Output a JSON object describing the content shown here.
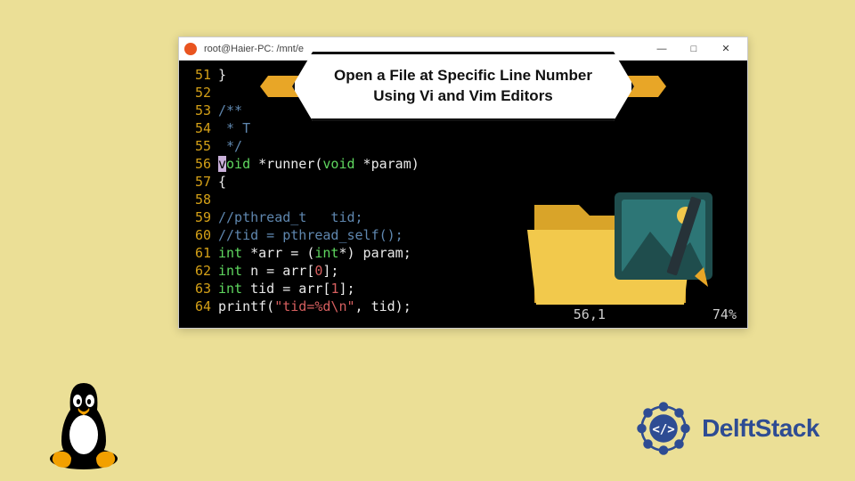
{
  "titlebar": {
    "title": "root@Haier-PC: /mnt/e",
    "min": "—",
    "max": "□",
    "close": "✕"
  },
  "overlay": {
    "line1": "Open a File at Specific Line Number",
    "line2": "Using Vi and Vim Editors"
  },
  "code": {
    "lines": [
      {
        "num": "51",
        "tokens": [
          {
            "cls": "tok-white",
            "t": "}"
          }
        ]
      },
      {
        "num": "52",
        "tokens": []
      },
      {
        "num": "53",
        "tokens": [
          {
            "cls": "tok-comment",
            "t": "/**"
          }
        ]
      },
      {
        "num": "54",
        "tokens": [
          {
            "cls": "tok-comment",
            "t": " * T"
          }
        ]
      },
      {
        "num": "55",
        "tokens": [
          {
            "cls": "tok-comment",
            "t": " */"
          }
        ]
      },
      {
        "num": "56",
        "tokens": [
          {
            "cls": "cursor-bg",
            "t": "v"
          },
          {
            "cls": "tok-keyword",
            "t": "oid"
          },
          {
            "cls": "tok-white",
            "t": " *runner("
          },
          {
            "cls": "tok-keyword",
            "t": "void"
          },
          {
            "cls": "tok-white",
            "t": " *param)"
          }
        ]
      },
      {
        "num": "57",
        "tokens": [
          {
            "cls": "tok-white",
            "t": "{"
          }
        ]
      },
      {
        "num": "58",
        "tokens": []
      },
      {
        "num": "59",
        "tokens": [
          {
            "cls": "tok-comment",
            "t": "//pthread_t   tid;"
          }
        ]
      },
      {
        "num": "60",
        "tokens": [
          {
            "cls": "tok-comment",
            "t": "//tid = pthread_self();"
          }
        ]
      },
      {
        "num": "61",
        "tokens": [
          {
            "cls": "tok-keyword",
            "t": "int"
          },
          {
            "cls": "tok-white",
            "t": " *arr = ("
          },
          {
            "cls": "tok-keyword",
            "t": "int"
          },
          {
            "cls": "tok-white",
            "t": "*) param;"
          }
        ]
      },
      {
        "num": "62",
        "tokens": [
          {
            "cls": "tok-keyword",
            "t": "int"
          },
          {
            "cls": "tok-white",
            "t": " n = arr["
          },
          {
            "cls": "tok-number",
            "t": "0"
          },
          {
            "cls": "tok-white",
            "t": "];"
          }
        ]
      },
      {
        "num": "63",
        "tokens": [
          {
            "cls": "tok-keyword",
            "t": "int"
          },
          {
            "cls": "tok-white",
            "t": " tid = arr["
          },
          {
            "cls": "tok-number",
            "t": "1"
          },
          {
            "cls": "tok-white",
            "t": "];"
          }
        ]
      },
      {
        "num": "64",
        "tokens": [
          {
            "cls": "tok-white",
            "t": "printf("
          },
          {
            "cls": "tok-string",
            "t": "\"tid=%d\\n\""
          },
          {
            "cls": "tok-white",
            "t": ", tid);"
          }
        ]
      }
    ]
  },
  "status": {
    "position": "56,1",
    "percent": "74%"
  },
  "brand": {
    "name": "DelftStack"
  }
}
